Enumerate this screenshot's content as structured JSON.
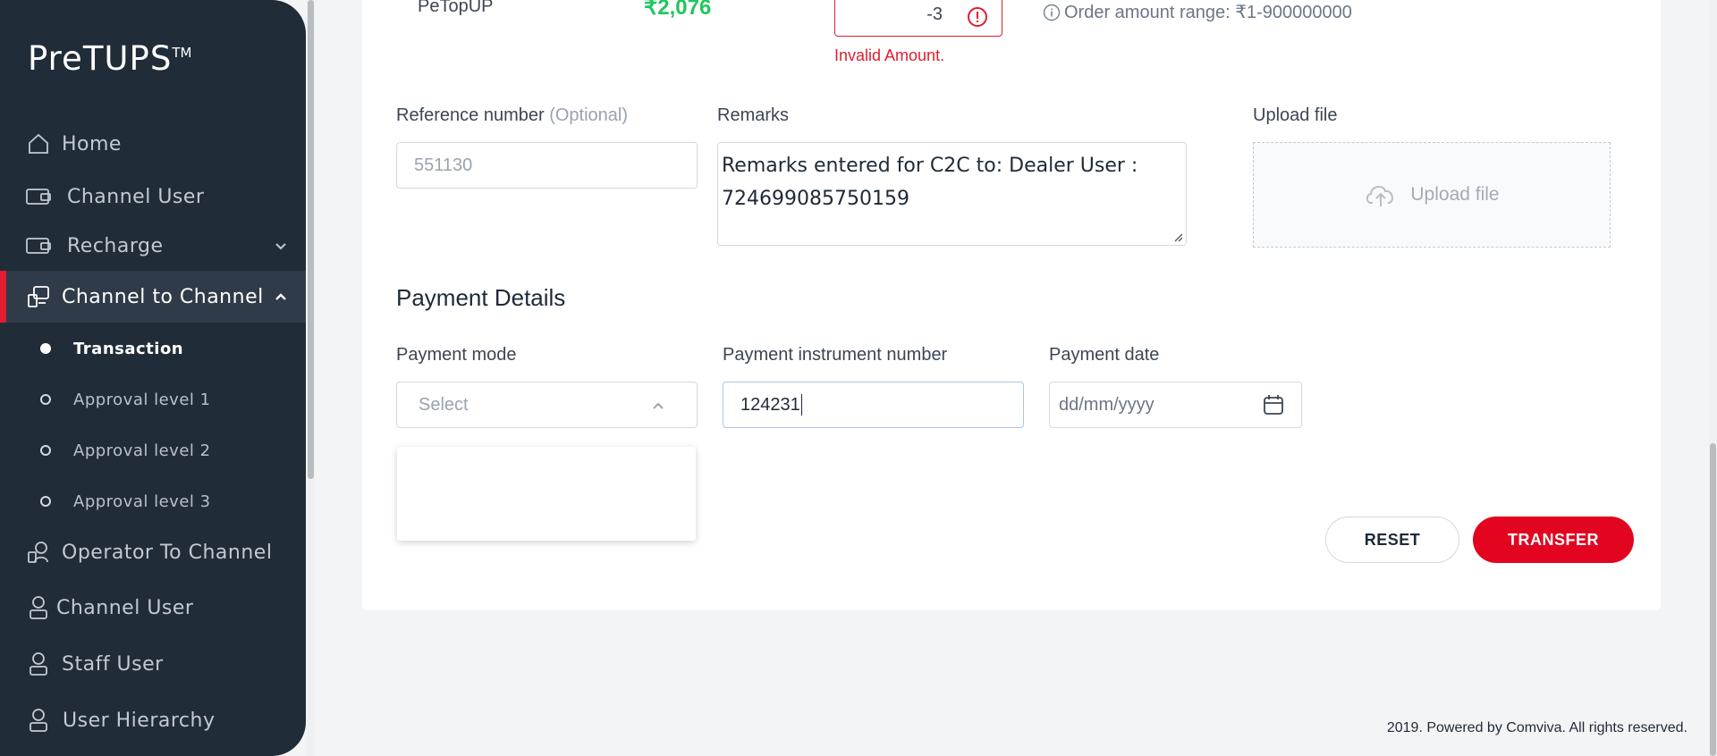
{
  "sidebar": {
    "logo": "PreTUPS",
    "logo_tm": "TM",
    "items": [
      {
        "label": "Home",
        "icon": "home-icon"
      },
      {
        "label": "Channel User",
        "icon": "wallet-icon"
      },
      {
        "label": "Recharge",
        "icon": "wallet-icon"
      },
      {
        "label": "Channel to Channel",
        "icon": "transfer-icon"
      },
      {
        "label": "Operator To Channel",
        "icon": "operator-transfer-icon"
      },
      {
        "label": "Channel User",
        "icon": "user-icon"
      },
      {
        "label": "Staff User",
        "icon": "user-icon"
      },
      {
        "label": "User Hierarchy",
        "icon": "user-icon"
      }
    ],
    "sub_items": [
      {
        "label": "Transaction"
      },
      {
        "label": "Approval level 1"
      },
      {
        "label": "Approval level 2"
      },
      {
        "label": "Approval level 3"
      }
    ]
  },
  "product": {
    "name": "PeTopUP",
    "balance": "₹2,076",
    "amount_value": "-3",
    "amount_error": "Invalid Amount.",
    "range_info": "Order amount range: ₹1-900000000"
  },
  "form": {
    "reference_label": "Reference number",
    "reference_optional": "(Optional)",
    "reference_placeholder": "551130",
    "remarks_label": "Remarks",
    "remarks_value": "Remarks entered for C2C to: Dealer User : 724699085750159",
    "upload_label": "Upload file",
    "upload_button": "Upload file"
  },
  "payment": {
    "section_title": "Payment Details",
    "mode_label": "Payment mode",
    "mode_placeholder": "Select",
    "instrument_label": "Payment instrument number",
    "instrument_value": "124231",
    "date_label": "Payment date",
    "date_placeholder": "dd/mm/yyyy"
  },
  "actions": {
    "reset": "RESET",
    "transfer": "TRANSFER"
  },
  "footer": {
    "copyright": "2019. Powered by Comviva. All rights reserved."
  },
  "colors": {
    "sidebar_bg": "#212c39",
    "accent": "#e11d2f",
    "success": "#22c55e"
  }
}
